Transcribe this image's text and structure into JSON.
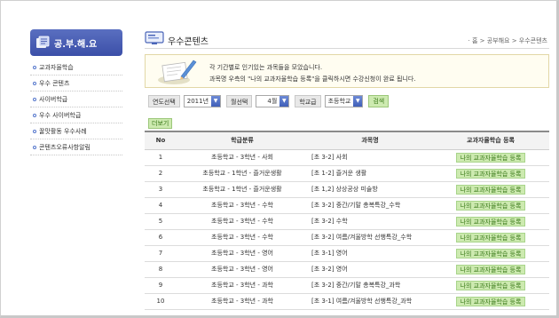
{
  "sidebar": {
    "title": "공.부.해.요",
    "items": [
      {
        "label": "교과자율학습"
      },
      {
        "label": "우수 콘텐츠"
      },
      {
        "label": "사이버학급"
      },
      {
        "label": "우수 사이버학급"
      },
      {
        "label": "꿀맛활동 우수사례"
      },
      {
        "label": "콘텐츠오류사항알림"
      }
    ]
  },
  "header": {
    "title": "우수콘텐츠",
    "breadcrumb": "· 홈 > 공부해요 > 우수콘텐츠"
  },
  "info": {
    "line1": "각 기간별로 인기있는 과목들을 모았습니다.",
    "line2": "과목명 우측의 \"나의 교과자율학습 등록\"을 클릭하시면 수강신청이 완료 됩니다."
  },
  "filters": {
    "year_label": "연도선택",
    "year_value": "2011년",
    "month_label": "월선택",
    "month_value": "4월",
    "level_label": "학교급",
    "level_value": "초등학교",
    "search_label": "검색"
  },
  "more_label": "더보기",
  "table": {
    "headers": {
      "no": "No",
      "category": "학급분류",
      "course": "과목명",
      "register": "교과자율학습 등록"
    },
    "register_label": "나의 교과자율학습 등록",
    "rows": [
      {
        "no": "1",
        "category": "초등학교 - 3학년 - 사회",
        "course": "[초 3-2] 사회"
      },
      {
        "no": "2",
        "category": "초등학교 - 1학년 - 즐거운생활",
        "course": "[초 1-2] 즐거운 생활"
      },
      {
        "no": "3",
        "category": "초등학교 - 1학년 - 즐거운생활",
        "course": "[초 1,2] 상상공상 미술방"
      },
      {
        "no": "4",
        "category": "초등학교 - 3학년 - 수학",
        "course": "[초 3-2] 중간/기말 총복특강_수학"
      },
      {
        "no": "5",
        "category": "초등학교 - 3학년 - 수학",
        "course": "[초 3-2] 수학"
      },
      {
        "no": "6",
        "category": "초등학교 - 3학년 - 수학",
        "course": "[초 3-2] 여름/겨울방학 선행특강_수학"
      },
      {
        "no": "7",
        "category": "초등학교 - 3학년 - 영어",
        "course": "[초 3-1] 영어"
      },
      {
        "no": "8",
        "category": "초등학교 - 3학년 - 영어",
        "course": "[초 3-2] 영어"
      },
      {
        "no": "9",
        "category": "초등학교 - 3학년 - 과학",
        "course": "[초 3-2] 중간/기말 총복특강_과학"
      },
      {
        "no": "10",
        "category": "초등학교 - 3학년 - 과학",
        "course": "[초 3-1] 여름/겨울방학 선행특강_과학"
      }
    ]
  },
  "colors": {
    "sidebar_title_bg": "#3b4fa8",
    "button_bg": "#cdeab0",
    "button_text": "#3a7a1a",
    "info_bg": "#fffdf1"
  }
}
